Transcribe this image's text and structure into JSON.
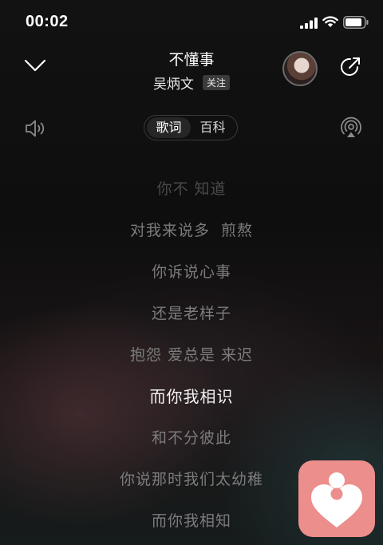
{
  "status_bar": {
    "time": "00:02",
    "icons": [
      "signal-icon",
      "wifi-icon",
      "battery-icon"
    ]
  },
  "header": {
    "song_title": "不懂事",
    "artist": "吴炳文",
    "follow_label": "关注",
    "icons": [
      "chevron-down-icon",
      "artist-avatar",
      "share-icon"
    ]
  },
  "controls": {
    "tabs": [
      {
        "label": "歌词",
        "active": true
      },
      {
        "label": "百科",
        "active": false
      }
    ],
    "icons": [
      "volume-icon",
      "airplay-icon"
    ]
  },
  "lyrics": [
    {
      "text": "你不 知道",
      "state": "faded"
    },
    {
      "text": "对我来说多  煎熬",
      "state": "normal"
    },
    {
      "text": "你诉说心事",
      "state": "normal"
    },
    {
      "text": "还是老样子",
      "state": "normal"
    },
    {
      "text": "抱怨 爱总是 来迟",
      "state": "normal"
    },
    {
      "text": "而你我相识",
      "state": "current"
    },
    {
      "text": "和不分彼此",
      "state": "normal"
    },
    {
      "text": "你说那时我们太幼稚",
      "state": "normal"
    },
    {
      "text": "而你我相知",
      "state": "normal"
    }
  ],
  "app_badge": {
    "icon": "heart-person-icon",
    "color": "#ec8e8c"
  },
  "colors": {
    "background": "#0d0d0d",
    "lyric_normal": "#7c7c7c",
    "lyric_current": "#f2f2f2"
  }
}
